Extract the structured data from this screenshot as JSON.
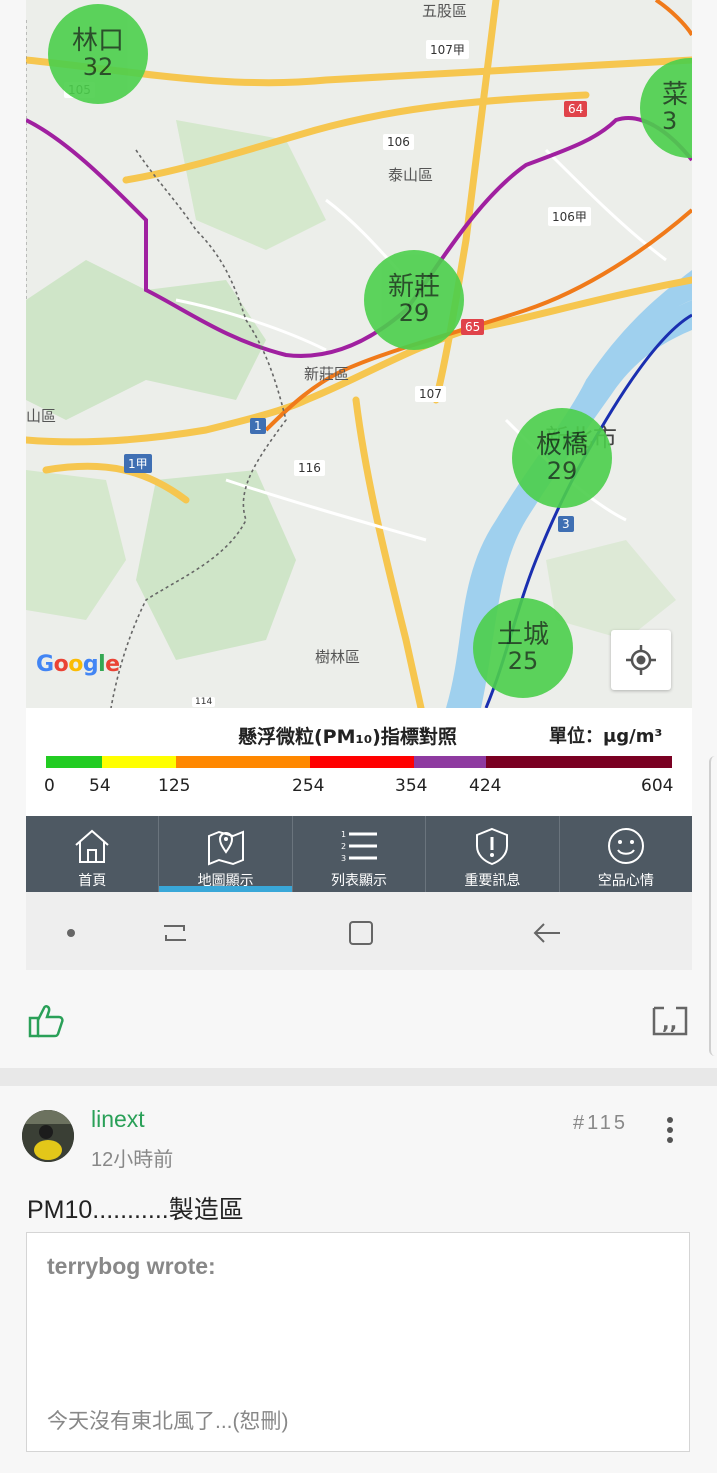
{
  "map": {
    "stations": [
      {
        "name": "林口",
        "value": "32"
      },
      {
        "name": "新莊",
        "value": "29"
      },
      {
        "name": "板橋",
        "value": "29"
      },
      {
        "name": "土城",
        "value": "25"
      },
      {
        "name": "菜",
        "value": "3"
      }
    ],
    "place_labels": {
      "wugu": "五股區",
      "taishan": "泰山區",
      "xinzhuang": "新莊區",
      "shulin": "樹林區",
      "xinbei": "新北市",
      "shan": "山區"
    },
    "road_numbers": {
      "r105": "105",
      "r107a": "107甲",
      "r106": "106",
      "r106a": "106甲",
      "r107": "107",
      "r116": "116",
      "r1a": "1甲",
      "r1": "1",
      "r64": "64",
      "r65": "65",
      "r3": "3",
      "r114": "114"
    },
    "attribution": "Google",
    "colors": {
      "bubble": "#4ccf4c",
      "metro_purple": "#a020a0",
      "metro_orange": "#f07a1a",
      "metro_blue": "#1a2fb0"
    }
  },
  "legend": {
    "title": "懸浮微粒(PM₁₀)指標對照",
    "unit": "單位：μg/m³",
    "ticks": [
      "0",
      "54",
      "125",
      "254",
      "354",
      "424",
      "604"
    ],
    "colors": [
      "#22cc22",
      "#ffff00",
      "#ff8800",
      "#ff0000",
      "#8e3aa0",
      "#7a0022"
    ]
  },
  "tabs": [
    {
      "label": "首頁",
      "icon": "home-icon",
      "active": false
    },
    {
      "label": "地圖顯示",
      "icon": "map-pin-icon",
      "active": true
    },
    {
      "label": "列表顯示",
      "icon": "list-icon",
      "active": false
    },
    {
      "label": "重要訊息",
      "icon": "shield-alert-icon",
      "active": false
    },
    {
      "label": "空品心情",
      "icon": "smiley-icon",
      "active": false
    }
  ],
  "post": {
    "username": "linext",
    "time": "12小時前",
    "number": "#115",
    "text": "PM10...........製造區",
    "quote": {
      "author": "terrybog wrote:",
      "body": "今天沒有東北風了...(恕刪)"
    }
  }
}
